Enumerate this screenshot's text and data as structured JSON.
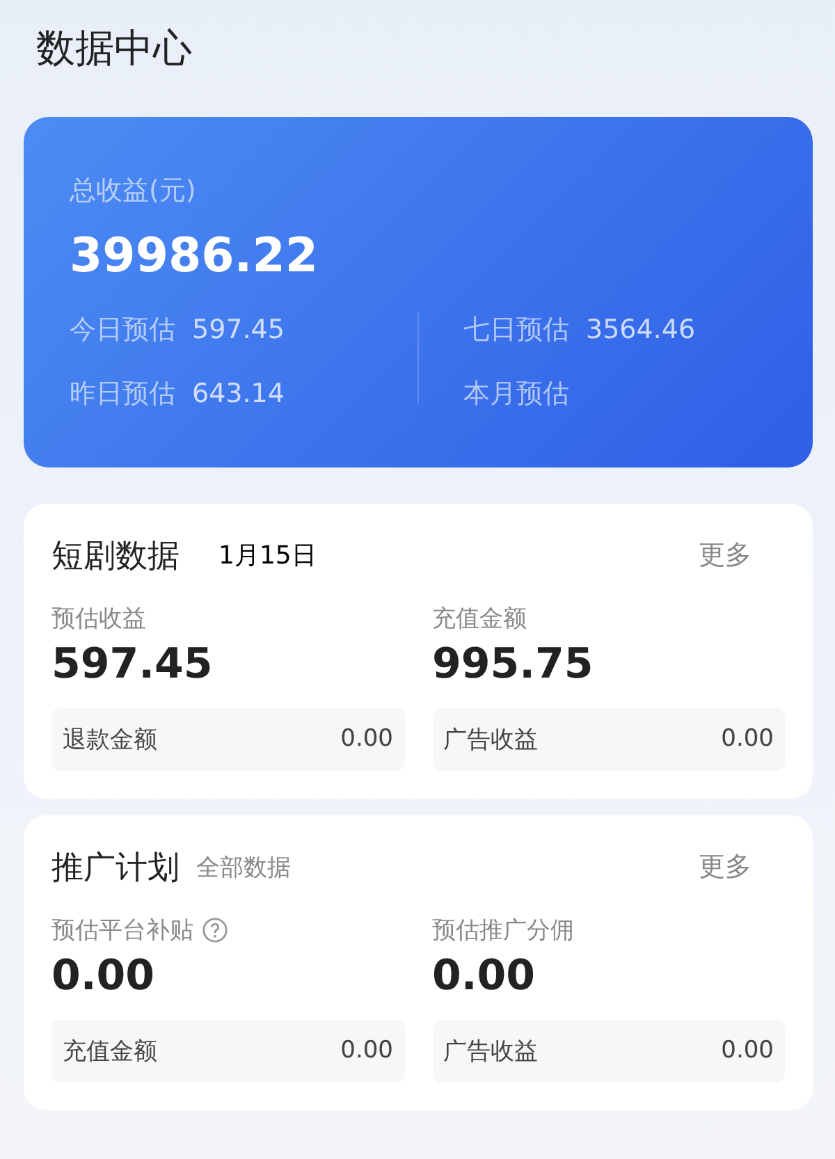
{
  "page_title": "数据中心",
  "summary": {
    "label": "总收益(元)",
    "value": "39986.22",
    "stats": [
      {
        "label": "今日预估",
        "value": "597.45"
      },
      {
        "label": "七日预估",
        "value": "3564.46"
      },
      {
        "label": "昨日预估",
        "value": "643.14"
      },
      {
        "label": "本月预估"
      }
    ]
  },
  "sections": [
    {
      "title": "短剧数据",
      "subtitle": "1月15日",
      "kind": "date",
      "more": "更多",
      "metrics": [
        {
          "label": "预估收益",
          "value": "597.45",
          "help": false
        },
        {
          "label": "充值金额",
          "value": "995.75",
          "help": false
        }
      ],
      "details": [
        {
          "label": "退款金额",
          "value": "0.00"
        },
        {
          "label": "广告收益",
          "value": "0.00"
        }
      ]
    },
    {
      "title": "推广计划",
      "subtitle": "全部数据",
      "kind": "tag",
      "more": "更多",
      "metrics": [
        {
          "label": "预估平台补贴",
          "value": "0.00",
          "help": true
        },
        {
          "label": "预估推广分佣",
          "value": "0.00",
          "help": false
        }
      ],
      "details": [
        {
          "label": "充值金额",
          "value": "0.00"
        },
        {
          "label": "广告收益",
          "value": "0.00"
        }
      ]
    }
  ]
}
